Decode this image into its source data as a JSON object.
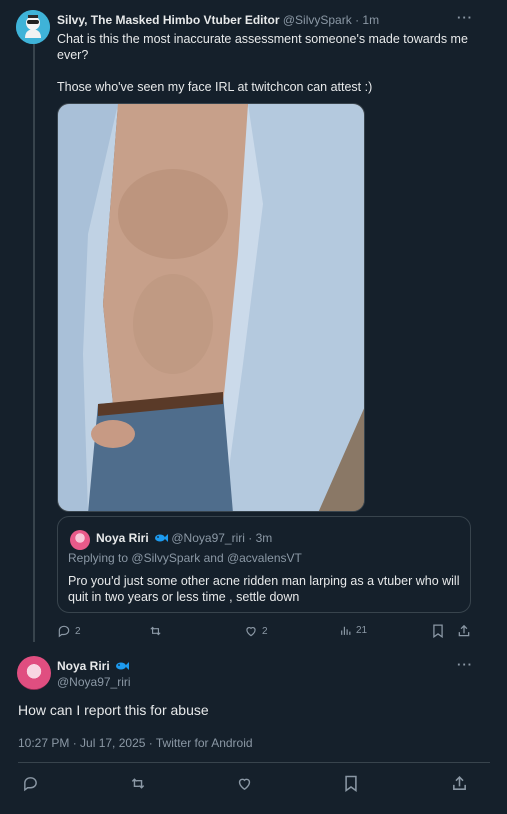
{
  "tweet1": {
    "author_name": "Silvy, The Masked Himbo Vtuber Editor",
    "author_handle": "@SilvySpark",
    "time": "· 1m",
    "text": "Chat is this the most inaccurate assessment someone's made towards me ever?\n\nThose who've seen my face IRL at twitchcon can attest :)",
    "quote": {
      "author_name": "Noya Riri",
      "author_handle": "@Noya97_riri",
      "time": "· 3m",
      "replying_prefix": "Replying to",
      "replying_users": "@SilvySpark and @acvalensVT",
      "text": "Pro you'd just some other acne ridden man larping as a vtuber who will quit in two years or less time , settle down"
    },
    "actions": {
      "replies": "2",
      "likes": "2",
      "views": "21"
    }
  },
  "tweet2": {
    "author_name": "Noya Riri",
    "author_handle": "@Noya97_riri",
    "text": "How can I report this for abuse",
    "meta": "10:27 PM · Jul 17, 2025 · Twitter for Android"
  },
  "colors": {
    "background": "#15202b",
    "muted": "#8b98a5",
    "border": "#38444d",
    "text": "#e7e9ea",
    "badge": "#1d9bf0"
  },
  "icons": [
    "reply-icon",
    "retweet-icon",
    "like-icon",
    "views-icon",
    "bookmark-icon",
    "share-icon",
    "more-icon",
    "fish-badge-icon"
  ]
}
